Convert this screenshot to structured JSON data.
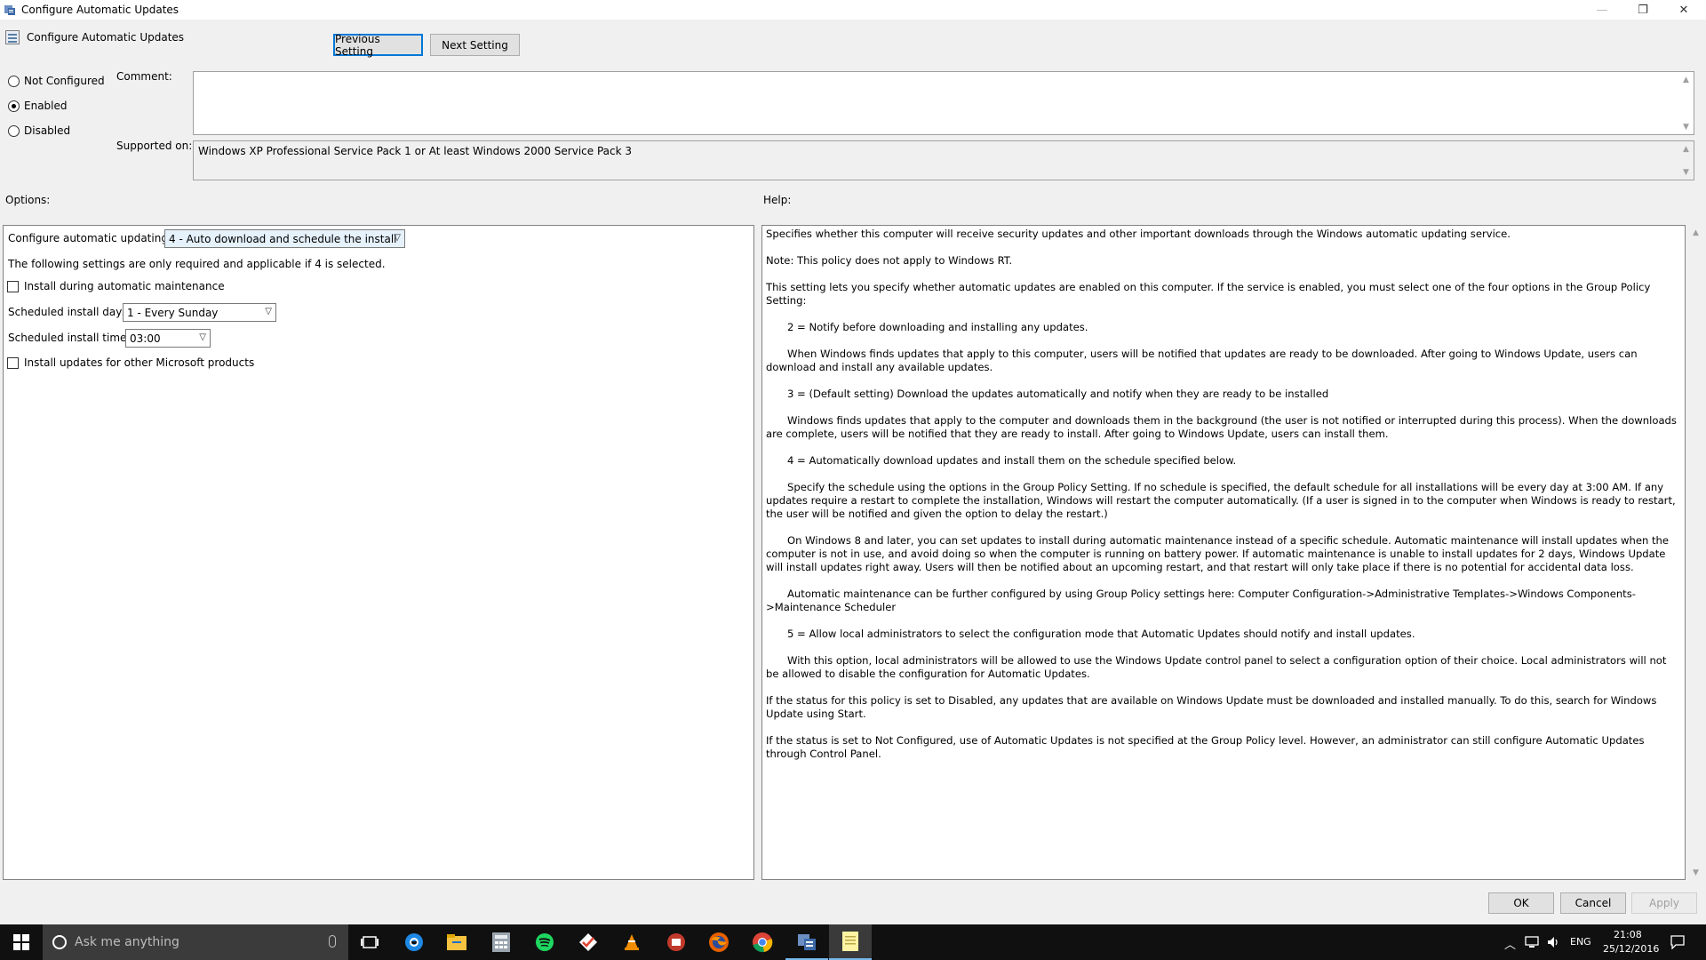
{
  "window": {
    "title": "Configure Automatic Updates",
    "controls": {
      "minimize": "—",
      "restore": "❐",
      "close": "✕"
    }
  },
  "header": {
    "policy_name": "Configure Automatic Updates",
    "prev_button": "Previous Setting",
    "next_button": "Next Setting"
  },
  "state": {
    "not_configured": "Not Configured",
    "enabled": "Enabled",
    "disabled": "Disabled",
    "selected": "Enabled"
  },
  "comment": {
    "label": "Comment:",
    "value": ""
  },
  "supported": {
    "label": "Supported on:",
    "value": "Windows XP Professional Service Pack 1 or At least Windows 2000 Service Pack 3"
  },
  "options": {
    "label": "Options:",
    "configure_label": "Configure automatic updating:",
    "configure_value": "4 - Auto download and schedule the install",
    "note": "The following settings are only required and applicable if 4 is selected.",
    "maintenance_checkbox": "Install during automatic maintenance",
    "day_label": "Scheduled install day:",
    "day_value": "1 - Every Sunday",
    "time_label": "Scheduled install time:",
    "time_value": "03:00",
    "other_products_checkbox": "Install updates for other Microsoft products"
  },
  "help": {
    "label": "Help:",
    "paragraphs": [
      "Specifies whether this computer will receive security updates and other important downloads through the Windows automatic updating service.",
      "Note: This policy does not apply to Windows RT.",
      "This setting lets you specify whether automatic updates are enabled on this computer. If the service is enabled, you must select one of the four options in the Group Policy Setting:",
      "2 = Notify before downloading and installing any updates.",
      "When Windows finds updates that apply to this computer, users will be notified that updates are ready to be downloaded. After going to Windows Update, users can download and install any available updates.",
      "3 = (Default setting) Download the updates automatically and notify when they are ready to be installed",
      "Windows finds updates that apply to the computer and downloads them in the background (the user is not notified or interrupted during this process). When the downloads are complete, users will be notified that they are ready to install. After going to Windows Update, users can install them.",
      "4 = Automatically download updates and install them on the schedule specified below.",
      "Specify the schedule using the options in the Group Policy Setting. If no schedule is specified, the default schedule for all installations will be every day at 3:00 AM. If any updates require a restart to complete the installation, Windows will restart the computer automatically. (If a user is signed in to the computer when Windows is ready to restart, the user will be notified and given the option to delay the restart.)",
      "On Windows 8 and later, you can set updates to install during automatic maintenance instead of a specific schedule. Automatic maintenance will install updates when the computer is not in use, and avoid doing so when the computer is running on battery power. If automatic maintenance is unable to install updates for 2 days, Windows Update will install updates right away. Users will then be notified about an upcoming restart, and that restart will only take place if there is no potential for accidental data loss.",
      "Automatic maintenance can be further configured by using Group Policy settings here: Computer Configuration->Administrative Templates->Windows Components->Maintenance Scheduler",
      "5 = Allow local administrators to select the configuration mode that Automatic Updates should notify and install updates.",
      "With this option, local administrators will be allowed to use the Windows Update control panel to select a configuration option of their choice. Local administrators will not be allowed to disable the configuration for Automatic Updates.",
      "If the status for this policy is set to Disabled, any updates that are available on Windows Update must be downloaded and installed manually. To do this, search for Windows Update using Start.",
      "If the status is set to Not Configured, use of Automatic Updates is not specified at the Group Policy level. However, an administrator can still configure Automatic Updates through Control Panel."
    ]
  },
  "footer": {
    "ok": "OK",
    "cancel": "Cancel",
    "apply": "Apply"
  },
  "taskbar": {
    "search_placeholder": "Ask me anything",
    "language": "ENG",
    "time": "21:08",
    "date": "25/12/2016",
    "apps": [
      "task-view-icon",
      "edge-icon",
      "file-explorer-icon",
      "calculator-icon",
      "spotify-icon",
      "todoist-icon",
      "vlc-icon",
      "app-icon",
      "firefox-icon",
      "chrome-icon",
      "group-policy-icon",
      "notes-icon"
    ]
  },
  "colors": {
    "accent": "#0078d7",
    "taskbar": "#101010",
    "search": "#3b3b3b"
  }
}
